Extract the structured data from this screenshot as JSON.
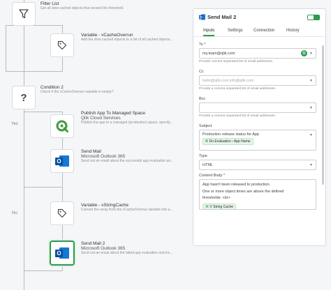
{
  "flow": {
    "yes_label": "Yes",
    "no_label": "No",
    "nodes": [
      {
        "title": "Filter List",
        "subtitle": "Get all slow cached objects that exceed the threshold.",
        "icon": "filter-icon"
      },
      {
        "title": "Variable - vCacheOverrun",
        "subtitle": "Add the slow cached objects to a list of all cached objects...",
        "icon": "tag-icon"
      },
      {
        "title": "Condition 2",
        "subtitle": "Check if the vCacheOverrun variable is empty?",
        "icon": "question-icon"
      },
      {
        "title": "Publish App To Managed Space",
        "subtitle": "Qlik Cloud Services",
        "subtitle2": "Publish the app to a managed (production) space, specify...",
        "icon": "qlik-icon"
      },
      {
        "title": "Send Mail",
        "subtitle": "Microsoft Outlook 365",
        "subtitle2": "Send out an email about the successful app evaluation an...",
        "icon": "outlook-icon"
      },
      {
        "title": "Variable - vStringCache",
        "subtitle": "Convert the array from the vCacheOverrun variable into a...",
        "icon": "tag-icon"
      },
      {
        "title": "Send Mail 2",
        "subtitle": "Microsoft Outlook 365",
        "subtitle2": "Send out an email about the failed app evaluation and inc...",
        "icon": "outlook-icon"
      }
    ]
  },
  "panel": {
    "title": "Send Mail 2",
    "tabs": [
      "Inputs",
      "Settings",
      "Connection",
      "History"
    ],
    "active_tab": "Inputs",
    "to": {
      "label": "To *",
      "value": "my.team@qlik.com",
      "help": "Provide comma separated list of email addresses."
    },
    "cc": {
      "label": "Cc",
      "placeholder": "hello@qlik.com,info@qlik.com",
      "help": "Provide a comma separated list of email addresses."
    },
    "bcc": {
      "label": "Bcc",
      "help": "Provide a comma separated list of email addresses."
    },
    "subject": {
      "label": "Subject",
      "text": "Production release status for App",
      "chip_step": "Do Evaluation",
      "chip_field": "App Name"
    },
    "type": {
      "label": "Type",
      "value": "HTML"
    },
    "content": {
      "label": "Content Body *",
      "line1": "App hasn't been released to production.",
      "line2": "One or more object times are above the defined",
      "line3": "thresholds: <br>",
      "chip": "V String Cache"
    }
  },
  "colors": {
    "accent": "#2b9a4c",
    "outlook_blue": "#0a4fa0",
    "line": "#b5bcc3"
  }
}
